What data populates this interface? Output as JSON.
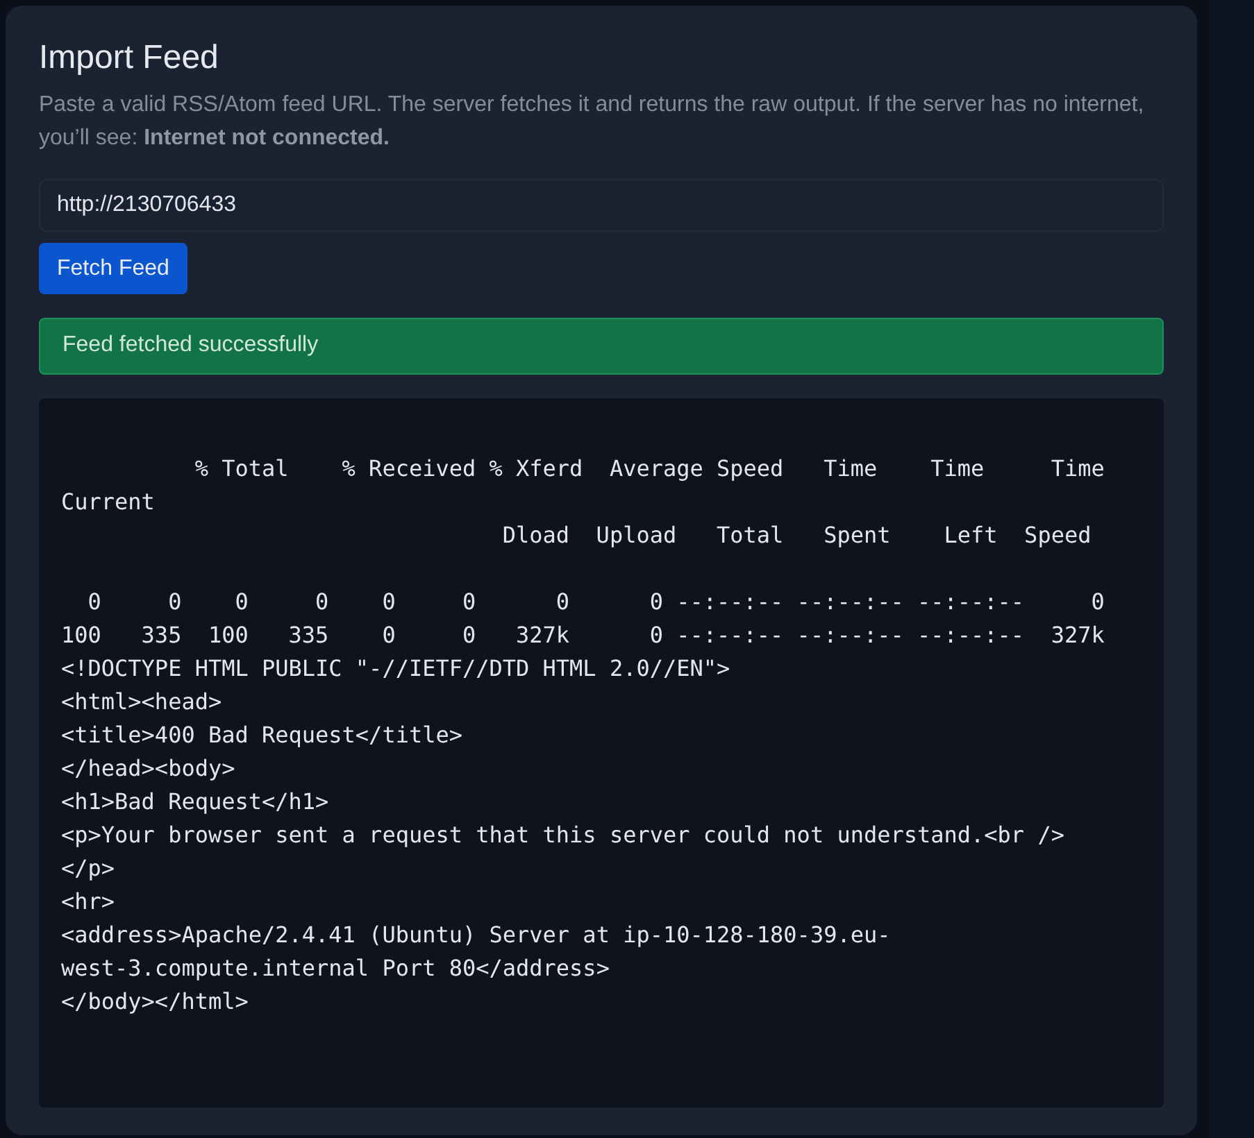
{
  "card": {
    "title": "Import Feed",
    "description": "Paste a valid RSS/Atom feed URL. The server fetches it and returns the raw output. If the server has no internet, you’ll see: **Internet not connected.**"
  },
  "url_field": {
    "value": "http://2130706433"
  },
  "fetch_button": {
    "label": "Fetch Feed"
  },
  "alert": {
    "kind": "success",
    "text": "Feed fetched successfully"
  },
  "output": "          % Total    % Received % Xferd  Average Speed   Time    Time     Time\nCurrent\n                                 Dload  Upload   Total   Spent    Left  Speed\n\n  0     0    0     0    0     0      0      0 --:--:-- --:--:-- --:--:--     0\n100   335  100   335    0     0   327k      0 --:--:-- --:--:-- --:--:--  327k\n<!DOCTYPE HTML PUBLIC \"-//IETF//DTD HTML 2.0//EN\">\n<html><head>\n<title>400 Bad Request</title>\n</head><body>\n<h1>Bad Request</h1>\n<p>Your browser sent a request that this server could not understand.<br />\n</p>\n<hr>\n<address>Apache/2.4.41 (Ubuntu) Server at ip-10-128-180-39.eu-\nwest-3.compute.internal Port 80</address>\n</body></html>"
}
